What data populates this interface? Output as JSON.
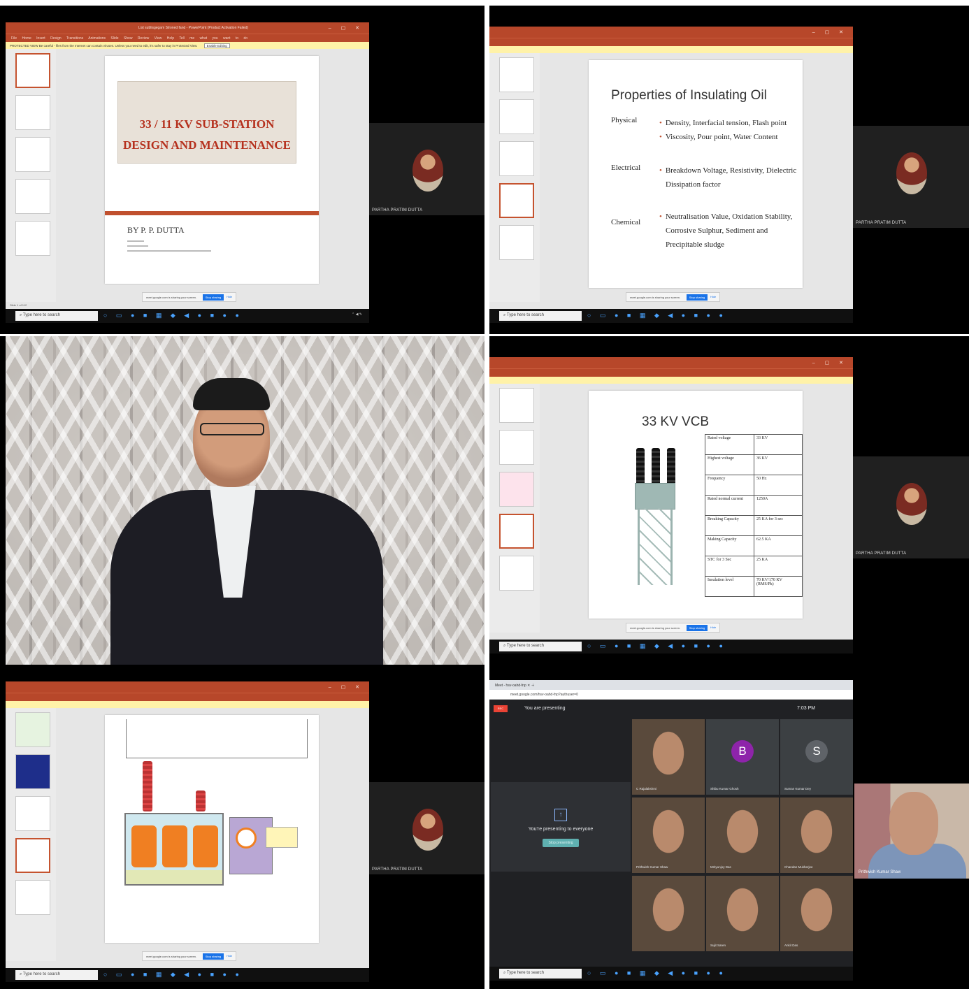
{
  "panels": {
    "p1": {
      "window_title": "List sublisgegam Stroned fand - PowerPoint (Product Activation Failed)",
      "ribbon_tabs": "File Home Insert Design Transitions Animations Slide Show Review View Help Tell me what you want to do",
      "protected_text": "PROTECTED VIEW Be careful - files from the Internet can contain viruses. Unless you need to edit, it's safer to stay in Protected View.",
      "enable_label": "Enable Editing",
      "slide_title_line1": "33 / 11 KV SUB-STATION",
      "slide_title_line2": "DESIGN AND MAINTENANCE",
      "slide_author": "BY P. P. DUTTA",
      "status": "Slide 1 of 112",
      "search_placeholder": "Type here to search",
      "sharing_text": "meet.google.com is sharing your screen.",
      "stop_sharing": "Stop sharing",
      "hide": "Hide",
      "self_name": "PARTHA PRATIM DUTTA"
    },
    "p2": {
      "slide_title": "Properties of Insulating Oil",
      "rows": [
        {
          "category": "Physical",
          "items": [
            "Density, Interfacial tension, Flash point",
            "Viscosity, Pour point, Water Content"
          ]
        },
        {
          "category": "Electrical",
          "items": [
            "Breakdown Voltage, Resistivity, Dielectric Dissipation factor"
          ]
        },
        {
          "category": "Chemical",
          "items": [
            "Neutralisation Value, Oxidation Stability, Corrosive Sulphur, Sediment and Precipitable sludge"
          ]
        }
      ],
      "search_placeholder": "Type here to search",
      "self_name": "PARTHA PRATIM DUTTA"
    },
    "p4": {
      "slide_title": "33 KV VCB",
      "spec_rows": [
        {
          "label": "Rated voltage",
          "value": "33 KV"
        },
        {
          "label": "Highest voltage",
          "value": "36 KV"
        },
        {
          "label": "Frequency",
          "value": "50 Hz"
        },
        {
          "label": "Rated normal current",
          "value": "1250A"
        },
        {
          "label": "Breaking Capacity",
          "value": "25 KA for 3 sec"
        },
        {
          "label": "Making Capacity",
          "value": "62.5 KA"
        },
        {
          "label": "STC for 3 Sec",
          "value": "25 KA"
        },
        {
          "label": "Insulation level",
          "value": "70 KV/170 KV (RMS/Pk)"
        }
      ],
      "search_placeholder": "Type here to search",
      "self_name": "PARTHA PRATIM DUTTA"
    },
    "p5": {
      "search_placeholder": "Type here to search",
      "self_name": "PARTHA PRATIM DUTTA"
    },
    "p6": {
      "tab": "Meet - hsv-oahd-fnp",
      "url": "meet.google.com/hsv-oahd-fnp?authuser=0",
      "you_are_presenting": "You are presenting",
      "presenting_to_everyone": "You're presenting to everyone",
      "stop_presenting": "Stop presenting",
      "clock": "7:03 PM",
      "participants": [
        {
          "name": "C Rajalakshmi",
          "initial": "",
          "color": "#3c4043"
        },
        {
          "name": "Shibu Kumar Ghosh",
          "initial": "B",
          "color": "#8e24aa"
        },
        {
          "name": "Suman Kumar Dey",
          "initial": "S",
          "color": "#5f6368"
        },
        {
          "name": "Prithwish Kumar Shaw",
          "initial": "",
          "color": "#3c4043"
        },
        {
          "name": "Mrityunjoy Das",
          "initial": "",
          "color": "#3c4043"
        },
        {
          "name": "Chandan Mukherjee",
          "initial": "",
          "color": "#3c4043"
        },
        {
          "name": "",
          "initial": "",
          "color": "#3c4043"
        },
        {
          "name": "Sujit Saren",
          "initial": "",
          "color": "#3c4043"
        },
        {
          "name": "Ankit Das",
          "initial": "",
          "color": "#3c4043"
        }
      ],
      "right_name": "Prithwish Kumar Shaw",
      "search_placeholder": "Type here to search"
    }
  },
  "icons": [
    "search-icon",
    "windows-icon",
    "chrome-icon",
    "camera-icon",
    "present-icon"
  ]
}
